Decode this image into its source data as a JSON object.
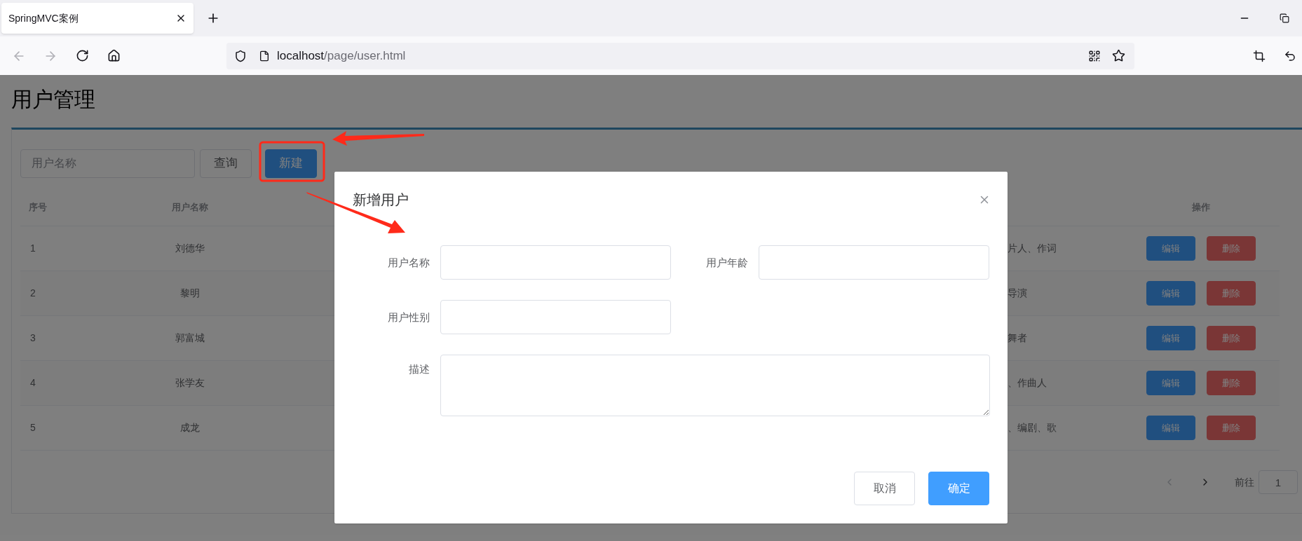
{
  "browser": {
    "tab": {
      "title": "SpringMVC案例"
    },
    "url": {
      "host": "localhost",
      "path": "/page/user.html"
    }
  },
  "page": {
    "title": "用户管理",
    "search": {
      "placeholder": "用户名称"
    },
    "buttons": [
      {
        "label": "查询",
        "kind": "default"
      },
      {
        "label": "新建",
        "kind": "primary"
      }
    ],
    "table": {
      "columns": {
        "index": "序号",
        "name": "用户名称",
        "actions": "操作"
      },
      "rows": [
        {
          "index": "1",
          "name": "刘德华",
          "description": "片人、作词",
          "actions": [
            {
              "label": "编辑",
              "kind": "primary"
            },
            {
              "label": "删除",
              "kind": "danger"
            }
          ]
        },
        {
          "index": "2",
          "name": "黎明",
          "description": "导演",
          "actions": [
            {
              "label": "编辑",
              "kind": "primary"
            },
            {
              "label": "删除",
              "kind": "danger"
            }
          ]
        },
        {
          "index": "3",
          "name": "郭富城",
          "description": "舞者",
          "actions": [
            {
              "label": "编辑",
              "kind": "primary"
            },
            {
              "label": "删除",
              "kind": "danger"
            }
          ]
        },
        {
          "index": "4",
          "name": "张学友",
          "description": "、作曲人",
          "actions": [
            {
              "label": "编辑",
              "kind": "primary"
            },
            {
              "label": "删除",
              "kind": "danger"
            }
          ]
        },
        {
          "index": "5",
          "name": "成龙",
          "description": "、编剧、歌",
          "actions": [
            {
              "label": "编辑",
              "kind": "primary"
            },
            {
              "label": "删除",
              "kind": "danger"
            }
          ]
        }
      ]
    },
    "pagination": {
      "prev": {
        "disabled": true
      },
      "next": {
        "disabled": false
      },
      "jump_label": "前往",
      "jump_value": "1"
    }
  },
  "modal": {
    "title": "新增用户",
    "fields": [
      {
        "label": "用户名称",
        "kind": "input"
      },
      {
        "label": "用户年龄",
        "kind": "input"
      },
      {
        "label": "用户性别",
        "kind": "input"
      },
      {
        "label": "描述",
        "kind": "textarea"
      }
    ],
    "buttons": [
      {
        "label": "取消",
        "kind": "default"
      },
      {
        "label": "确定",
        "kind": "primary"
      }
    ]
  }
}
